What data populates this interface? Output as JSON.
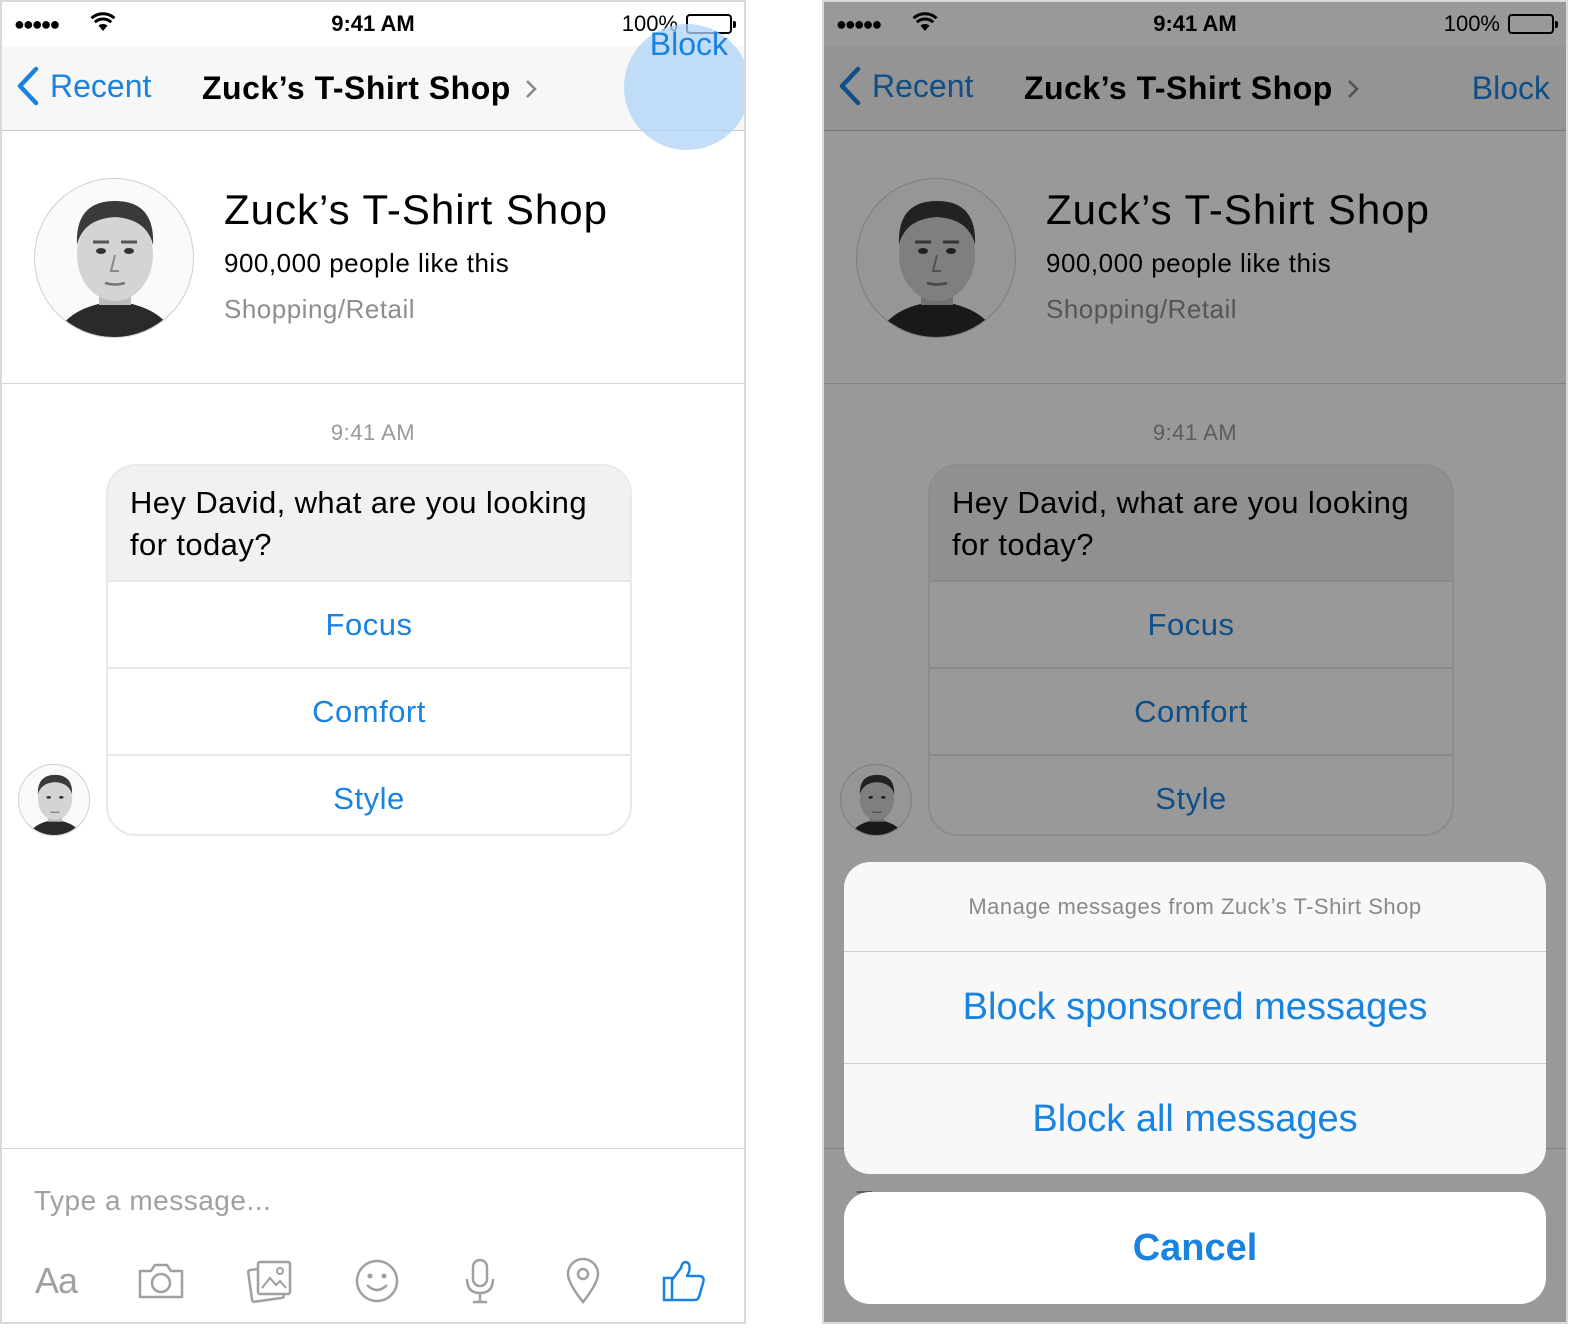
{
  "status_bar": {
    "time": "9:41 AM",
    "battery": "100%"
  },
  "nav": {
    "back_label": "Recent",
    "title": "Zuck’s T-Shirt Shop",
    "action_label": "Block"
  },
  "profile": {
    "name": "Zuck’s T-Shirt Shop",
    "likes": "900,000 people like this",
    "category": "Shopping/Retail"
  },
  "conversation": {
    "timestamp": "9:41 AM",
    "message": "Hey David, what are you looking for today?",
    "options": [
      "Focus",
      "Comfort",
      "Style"
    ]
  },
  "composer": {
    "placeholder": "Type a message...",
    "tools": [
      "text-format-icon",
      "camera-icon",
      "photo-icon",
      "emoji-icon",
      "microphone-icon",
      "location-icon",
      "thumbs-up-icon"
    ],
    "text_format_label": "Aa"
  },
  "action_sheet": {
    "header": "Manage messages from Zuck’s T-Shirt Shop",
    "actions": [
      "Block sponsored messages",
      "Block all messages"
    ],
    "cancel_label": "Cancel"
  },
  "colors": {
    "accent": "#1a83e0",
    "tap_highlight": "#add3f5",
    "overlay": "rgba(0,0,0,0.4)"
  }
}
